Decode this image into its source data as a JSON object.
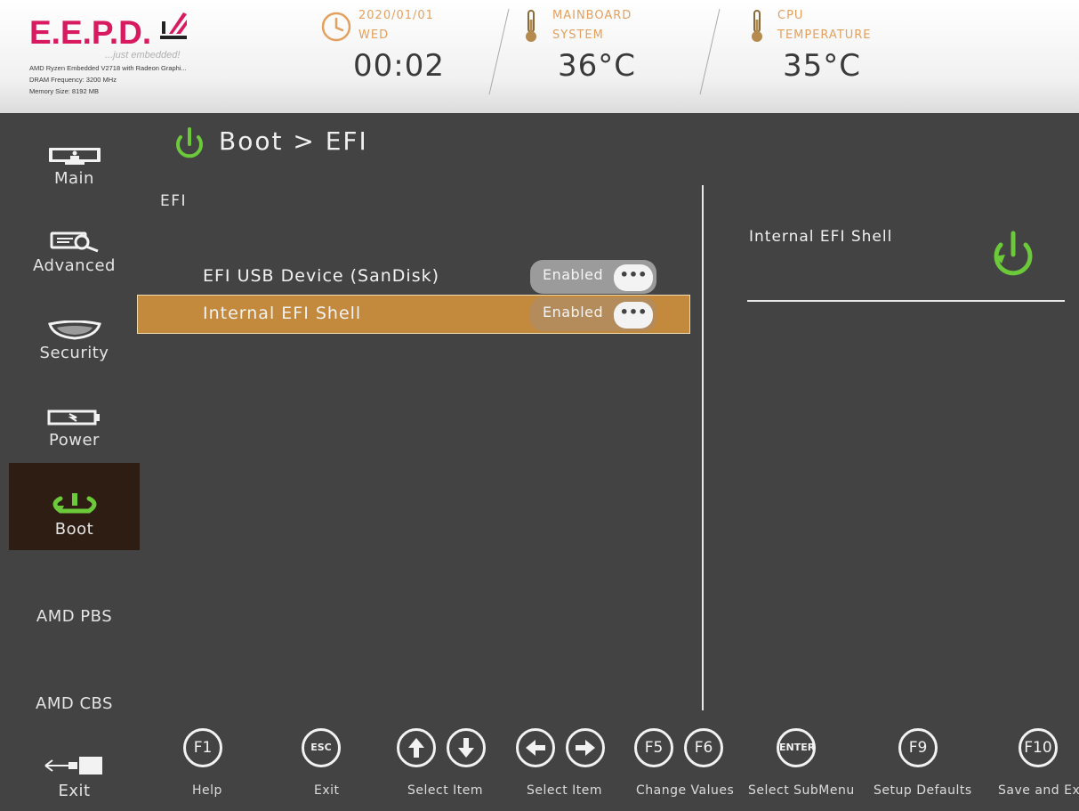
{
  "header": {
    "logo_text": "E.E.P.D.",
    "tagline": "...just embedded!",
    "cpu_info": "AMD Ryzen Embedded V2718 with Radeon Graphi...",
    "dram_info": "DRAM Frequency: 3200 MHz",
    "memory_info": "Memory Size: 8192 MB",
    "date": "2020/01/01",
    "weekday": "WED",
    "time": "00:02",
    "mainboard_label_1": "MAINBOARD",
    "mainboard_label_2": "SYSTEM",
    "mainboard_temp": "36°C",
    "cpu_label_1": "CPU",
    "cpu_label_2": "TEMPERATURE",
    "cpu_temp": "35°C"
  },
  "sidebar": {
    "items": [
      {
        "label": "Main"
      },
      {
        "label": "Advanced"
      },
      {
        "label": "Security"
      },
      {
        "label": "Power"
      },
      {
        "label": "Boot"
      },
      {
        "label": "AMD PBS"
      },
      {
        "label": "AMD CBS"
      },
      {
        "label": "Exit"
      }
    ],
    "active": "Boot"
  },
  "main": {
    "title": "Boot > EFI",
    "section": "EFI",
    "rows": [
      {
        "label": "EFI USB Device (SanDisk)",
        "value": "Enabled",
        "more": "•••"
      },
      {
        "label": "Internal EFI Shell",
        "value": "Enabled",
        "more": "•••"
      }
    ],
    "selected_row": "Internal EFI Shell"
  },
  "help": {
    "title": "Internal EFI Shell"
  },
  "footer": {
    "keys": [
      {
        "keys": [
          "F1"
        ],
        "label": "Help"
      },
      {
        "keys": [
          "ESC"
        ],
        "label": "Exit"
      },
      {
        "keys": [
          "up-arrow-icon",
          "down-arrow-icon"
        ],
        "label": "Select Item"
      },
      {
        "keys": [
          "left-arrow-icon",
          "right-arrow-icon"
        ],
        "label": "Select Item"
      },
      {
        "keys": [
          "F5",
          "F6"
        ],
        "label": "Change Values"
      },
      {
        "keys": [
          "ENTER"
        ],
        "label": "Select SubMenu"
      },
      {
        "keys": [
          "F9"
        ],
        "label": "Setup Defaults"
      },
      {
        "keys": [
          "F10"
        ],
        "label": "Save and Ex"
      }
    ]
  },
  "colors": {
    "accent_green": "#6cc93a",
    "logo_pink": "#d81b60",
    "header_orange": "#e3a05e",
    "selected_row": "#c38a3e",
    "background": "#434343"
  }
}
